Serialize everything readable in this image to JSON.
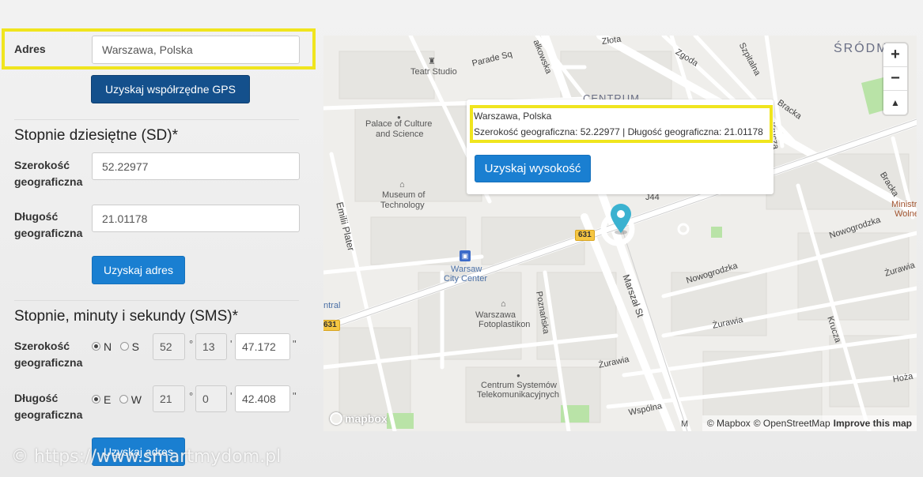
{
  "form": {
    "address_label": "Adres",
    "address_value": "Warszawa, Polska",
    "gps_button": "Uzyskaj współrzędne GPS",
    "sd_heading": "Stopnie dziesiętne (SD)*",
    "lat_label_1": "Szerokość",
    "lat_label_2": "geograficzna",
    "lat_value": "52.22977",
    "lng_label_1": "Długość",
    "lng_label_2": "geograficzna",
    "lng_value": "21.01178",
    "get_address_button": "Uzyskaj adres",
    "sms_heading": "Stopnie, minuty i sekundy (SMS)*",
    "sms_lat": {
      "label_1": "Szerokość",
      "label_2": "geograficzna",
      "opt1": "N",
      "opt2": "S",
      "deg": "52",
      "min": "13",
      "sec": "47.172"
    },
    "sms_lng": {
      "label_1": "Długość",
      "label_2": "geograficzna",
      "opt1": "E",
      "opt2": "W",
      "deg": "21",
      "min": "0",
      "sec": "42.408"
    },
    "sym_deg": "°",
    "sym_min": "'",
    "sym_sec": "\"",
    "get_address_button_2": "Uzyskaj adres"
  },
  "watermark": "© https://www.smartmydom.pl",
  "map": {
    "popup": {
      "line1": "Warszawa, Polska",
      "line2": "Szerokość geograficzna: 52.22977 | Długość geograficzna: 21.01178",
      "button": "Uzyskaj wysokość"
    },
    "zoom_in": "+",
    "zoom_out": "−",
    "compass": "▲",
    "labels": {
      "teatr": "Teatr Studio",
      "palace_1": "Palace of Culture",
      "palace_2": "and Science",
      "museum_1": "Museum of",
      "museum_2": "Technology",
      "warsaw_1": "Warsaw",
      "warsaw_2": "City Center",
      "foto_1": "Warszawa",
      "foto_2": "Fotoplastikon",
      "centrum_1": "Centrum Systemów",
      "centrum_2": "Telekomunikacyjnych",
      "srodm": "ŚRÓDM",
      "centrum_district": "CENTRUM",
      "ministry_1": "Ministry",
      "ministry_2": "Wolne",
      "ntral": "ntral"
    },
    "streets": {
      "zlota": "Złota",
      "zgoda": "Zgoda",
      "szpitalna": "Szpitalna",
      "bracka": "Bracka",
      "bracka2": "Bracka",
      "krucza": "Krucza",
      "krucza2": "Krucza",
      "parade": "Parade Sq",
      "emilii": "Emilii Plater",
      "marszal": "Marszał St",
      "nowogrodzka": "Nowogrodzka",
      "nowogrodzka2": "Nowogrodzka",
      "zurawia": "Żurawia",
      "zurawia2": "Żurawia",
      "zurawia3": "Żurawia",
      "poznanska": "Poznańska",
      "wspolna": "Wspólna",
      "hoza": "Hoża",
      "marszalk": "ałkowska",
      "j44": "J44",
      "m": "M"
    },
    "shield_631": "631",
    "shield_631_b": "631",
    "mapbox": "mapbox",
    "attribution": {
      "mapbox": "© Mapbox",
      "osm": "© OpenStreetMap",
      "improve": "Improve this map"
    },
    "colors": {
      "marker": "#3bb2d0",
      "park": "#b9e3a7",
      "highlight": "#f0e51e"
    }
  }
}
